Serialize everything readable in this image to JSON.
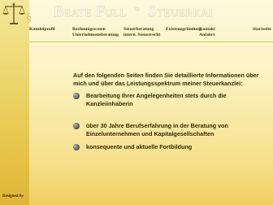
{
  "header": {
    "brand_name": "Beate Full",
    "separator": "*",
    "brand_suffix": "Steuerkai"
  },
  "nav": {
    "items": [
      {
        "label": "Kanzleiprofil"
      },
      {
        "label": "Rechnungswesen"
      },
      {
        "label": "Unternehmensberatung"
      },
      {
        "label": "Steuerberatung"
      },
      {
        "label": "intern. Steuerrecht"
      },
      {
        "label": "Existenzgründung"
      },
      {
        "label": "Kontakt"
      },
      {
        "label": "Anfahrt"
      },
      {
        "label": "Startseite"
      }
    ]
  },
  "content": {
    "intro": "Auf den folgenden Seiten finden Sie detaillierte Informationen über mich und über das Leistungsspektrum meiner Steuerkanzlei:",
    "bullets": [
      {
        "text": "Bearbeitung Ihrer Angelegenheiten stets durch die Kanzleiinhaberin"
      },
      {
        "text": "über 30 Jahre Berufserfahrung in der Beratung von Einzelunternehmen und Kapitalgesellschaften"
      },
      {
        "text": "konsequente und aktuelle Fortbildung"
      }
    ]
  },
  "footer": {
    "credit": "Designed by"
  },
  "colors": {
    "sidebar": "#e6c346",
    "main_top": "#fdf9dd",
    "main_bottom": "#f0cf63",
    "text": "#332900"
  },
  "icons": {
    "logo": "scales-of-justice-icon",
    "bullet": "sphere-bullet-icon"
  }
}
